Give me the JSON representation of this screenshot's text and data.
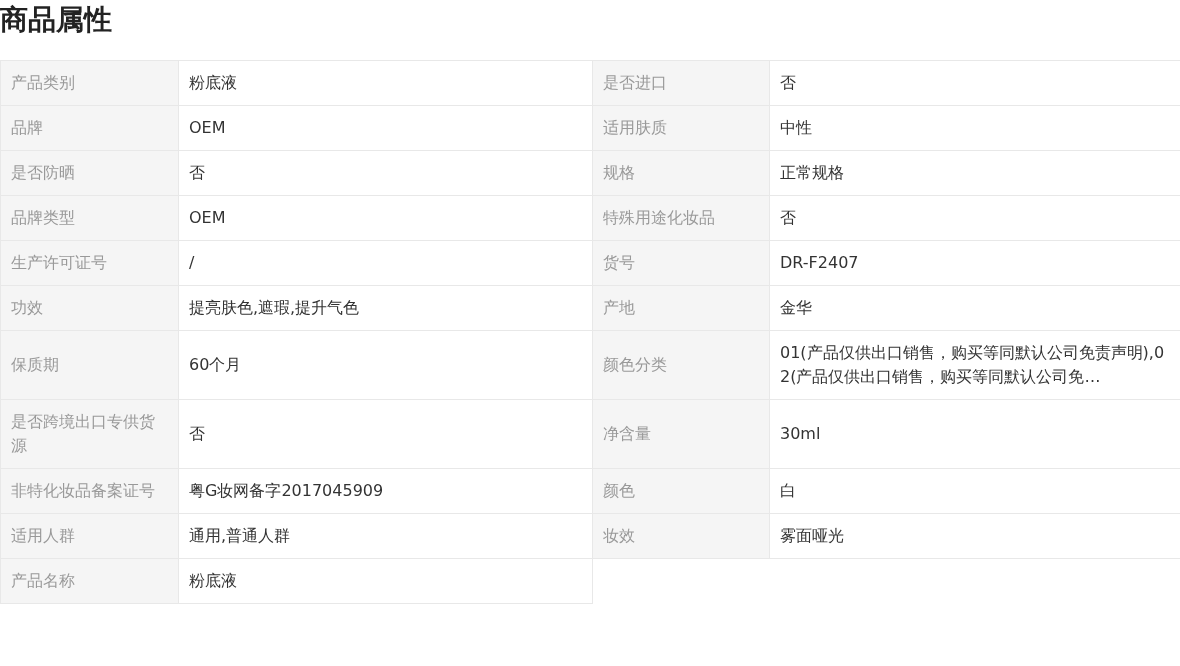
{
  "title": "商品属性",
  "rows": [
    [
      {
        "label": "产品类别",
        "value": "粉底液"
      },
      {
        "label": "是否进口",
        "value": "否"
      }
    ],
    [
      {
        "label": "品牌",
        "value": "OEM"
      },
      {
        "label": "适用肤质",
        "value": "中性"
      }
    ],
    [
      {
        "label": "是否防晒",
        "value": "否"
      },
      {
        "label": "规格",
        "value": "正常规格"
      }
    ],
    [
      {
        "label": "品牌类型",
        "value": "OEM"
      },
      {
        "label": "特殊用途化妆品",
        "value": "否"
      }
    ],
    [
      {
        "label": "生产许可证号",
        "value": "/"
      },
      {
        "label": "货号",
        "value": "DR-F2407"
      }
    ],
    [
      {
        "label": "功效",
        "value": "提亮肤色,遮瑕,提升气色"
      },
      {
        "label": "产地",
        "value": "金华"
      }
    ],
    [
      {
        "label": "保质期",
        "value": "60个月"
      },
      {
        "label": "颜色分类",
        "value": "01(产品仅供出口销售，购买等同默认公司免责声明),02(产品仅供出口销售，购买等同默认公司免…"
      }
    ],
    [
      {
        "label": "是否跨境出口专供货源",
        "value": "否"
      },
      {
        "label": "净含量",
        "value": "30ml"
      }
    ],
    [
      {
        "label": "非特化妆品备案证号",
        "value": "粤G妆网备字2017045909"
      },
      {
        "label": "颜色",
        "value": "白"
      }
    ],
    [
      {
        "label": "适用人群",
        "value": "通用,普通人群"
      },
      {
        "label": "妆效",
        "value": "雾面哑光"
      }
    ],
    [
      {
        "label": "产品名称",
        "value": "粉底液"
      }
    ]
  ]
}
